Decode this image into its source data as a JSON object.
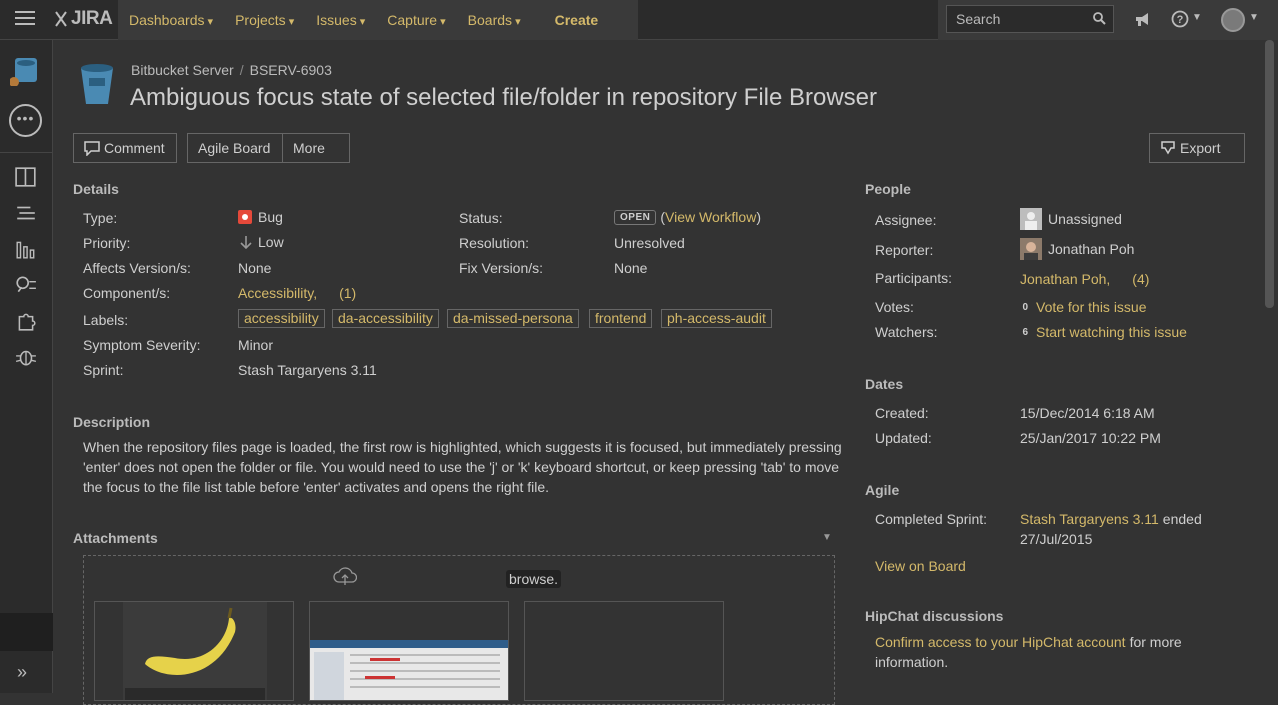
{
  "topbar": {
    "logo_text": "JIRA",
    "nav": [
      "Dashboards",
      "Projects",
      "Issues",
      "Capture",
      "Boards"
    ],
    "create_label": "Create",
    "search_placeholder": "Search"
  },
  "sidebar": {
    "icons": [
      "board-icon",
      "backlog-icon",
      "reports-icon",
      "search-issues-icon",
      "add-ons-icon",
      "issues-icon"
    ]
  },
  "issue": {
    "breadcrumb": [
      "Bitbucket Server",
      "BSERV-6903"
    ],
    "summary": "Ambiguous focus state of selected file/folder in repository File Browser"
  },
  "actions": {
    "comment": "Comment",
    "agile_board": "Agile Board",
    "more": "More",
    "export": "Export"
  },
  "details": {
    "title": "Details",
    "type_label": "Type:",
    "type_value": "Bug",
    "priority_label": "Priority:",
    "priority_value": "Low",
    "affects_label": "Affects Version/s:",
    "affects_value": "None",
    "component_label": "Component/s:",
    "component_value": "Accessibility,",
    "component_more": "(1)",
    "labels_label": "Labels:",
    "labels": [
      "accessibility",
      "da-accessibility",
      "da-missed-persona",
      "frontend",
      "ph-access-audit"
    ],
    "severity_label": "Symptom Severity:",
    "severity_value": "Minor",
    "sprint_label": "Sprint:",
    "sprint_value": "Stash Targaryens 3.11",
    "status_label": "Status:",
    "status_value": "OPEN",
    "view_workflow": "View Workflow",
    "resolution_label": "Resolution:",
    "resolution_value": "Unresolved",
    "fix_label": "Fix Version/s:",
    "fix_value": "None"
  },
  "description": {
    "title": "Description",
    "text": "When the repository files page is loaded, the first row is highlighted, which suggests it is focused, but immediately pressing 'enter' does not open the folder or file. You would need to use the 'j' or 'k' keyboard shortcut, or keep pressing 'tab' to move the focus to the file list table before 'enter' activates and opens the right file."
  },
  "attachments": {
    "title": "Attachments",
    "browse": "browse."
  },
  "people": {
    "title": "People",
    "assignee_label": "Assignee:",
    "assignee_value": "Unassigned",
    "reporter_label": "Reporter:",
    "reporter_value": "Jonathan Poh",
    "participants_label": "Participants:",
    "participants_value": "Jonathan Poh,",
    "participants_more": "(4)",
    "votes_label": "Votes:",
    "votes_count": "0",
    "votes_link": "Vote for this issue",
    "watchers_label": "Watchers:",
    "watchers_count": "6",
    "watchers_link": "Start watching this issue"
  },
  "dates": {
    "title": "Dates",
    "created_label": "Created:",
    "created_value": "15/Dec/2014 6:18 AM",
    "updated_label": "Updated:",
    "updated_value": "25/Jan/2017 10:22 PM"
  },
  "agile": {
    "title": "Agile",
    "completed_label": "Completed Sprint:",
    "completed_sprint": "Stash Targaryens 3.11",
    "ended_text": "ended",
    "ended_date": "27/Jul/2015",
    "view_on_board": "View on Board"
  },
  "hipchat": {
    "title": "HipChat discussions",
    "link": "Confirm access to your HipChat account",
    "suffix": "for more",
    "suffix2": "information."
  },
  "colors": {
    "accent": "#d4b96a",
    "background": "#333333",
    "topbar": "#2b2b2b"
  }
}
